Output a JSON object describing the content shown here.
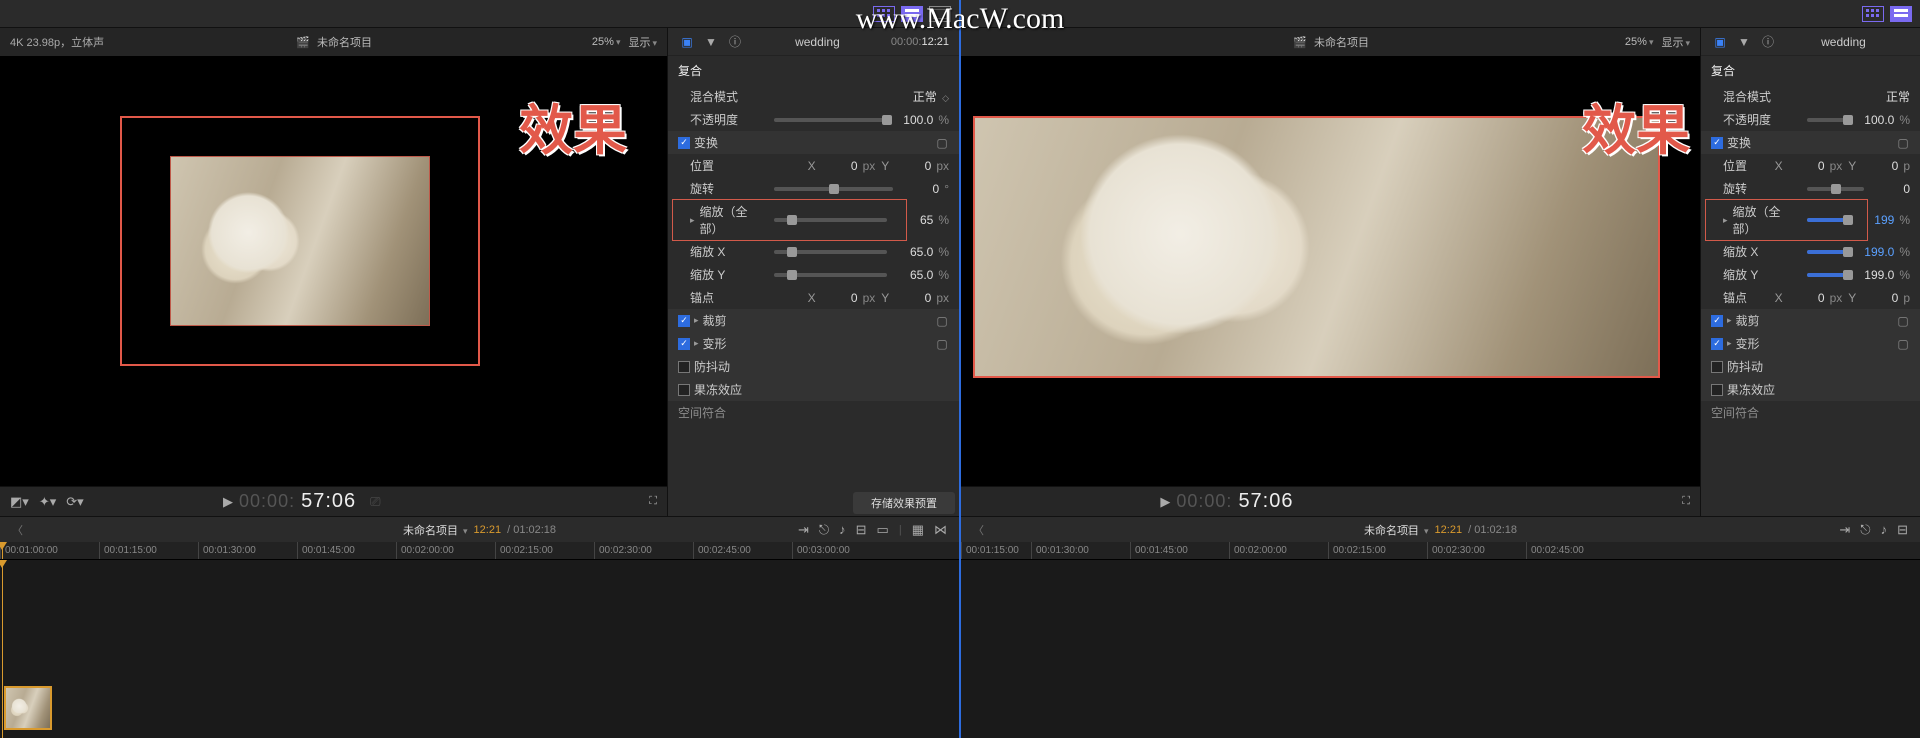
{
  "watermark": "www.MacW.com",
  "effect_label": "效果",
  "left": {
    "viewer": {
      "meta": "4K 23.98p，立体声",
      "title": "未命名项目",
      "zoom": "25%",
      "display": "显示"
    },
    "inspector": {
      "clip": "wedding",
      "timecode_dim": "00:00:",
      "timecode_bright": "12:21",
      "sections": {
        "composite": "复合",
        "blend_mode_label": "混合模式",
        "blend_mode_value": "正常",
        "opacity_label": "不透明度",
        "opacity_value": "100.0",
        "transform": "变换",
        "position": "位置",
        "pos_x": "0",
        "pos_y": "0",
        "rotation": "旋转",
        "rotation_value": "0",
        "scale_all": "缩放（全部）",
        "scale_all_value": "65",
        "scale_x": "缩放 X",
        "scale_x_value": "65.0",
        "scale_y": "缩放 Y",
        "scale_y_value": "65.0",
        "anchor": "锚点",
        "anchor_x": "0",
        "anchor_y": "0",
        "crop": "裁剪",
        "distort": "变形",
        "stabilize": "防抖动",
        "rolling": "果冻效应",
        "spatial": "空间符合"
      },
      "save_preset": "存储效果预置"
    },
    "transport": {
      "tc_dim": "00:00:",
      "tc_bright": "57:06"
    },
    "timeline": {
      "project": "未命名项目",
      "tc1": "12:21",
      "tc2": "01:02:18",
      "ticks": [
        "00:01:00:00",
        "00:01:15:00",
        "00:01:30:00",
        "00:01:45:00",
        "00:02:00:00",
        "00:02:15:00",
        "00:02:30:00",
        "00:02:45:00",
        "00:03:00:00"
      ]
    }
  },
  "right": {
    "viewer": {
      "title": "未命名项目",
      "zoom": "25%",
      "display": "显示"
    },
    "inspector": {
      "clip": "wedding",
      "sections": {
        "composite": "复合",
        "blend_mode_label": "混合模式",
        "blend_mode_value": "正常",
        "opacity_label": "不透明度",
        "opacity_value": "100.0",
        "transform": "变换",
        "position": "位置",
        "pos_x": "0",
        "pos_y": "0",
        "rotation": "旋转",
        "rotation_value": "0",
        "scale_all": "缩放（全部）",
        "scale_all_value": "199",
        "scale_x": "缩放 X",
        "scale_x_value": "199.0",
        "scale_y": "缩放 Y",
        "scale_y_value": "199.0",
        "anchor": "锚点",
        "anchor_x": "0",
        "anchor_y": "0",
        "crop": "裁剪",
        "distort": "变形",
        "stabilize": "防抖动",
        "rolling": "果冻效应",
        "spatial": "空间符合"
      }
    },
    "transport": {
      "tc_dim": "00:00:",
      "tc_bright": "57:06"
    },
    "timeline": {
      "project": "未命名项目",
      "tc1": "12:21",
      "tc2": "01:02:18",
      "ticks": [
        "00:01:15:00",
        "00:01:30:00",
        "00:01:45:00",
        "00:02:00:00",
        "00:02:15:00",
        "00:02:30:00",
        "00:02:45:00"
      ]
    }
  }
}
